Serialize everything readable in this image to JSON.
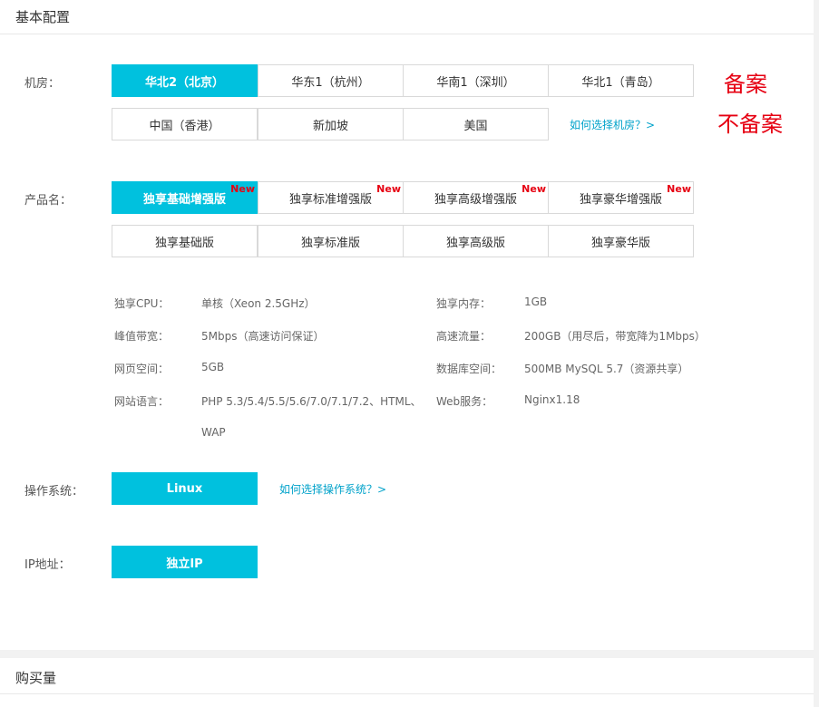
{
  "basic_config": {
    "title": "基本配置",
    "datacenter": {
      "label": "机房：",
      "options": [
        "华北2（北京）",
        "华东1（杭州）",
        "华南1（深圳）",
        "华北1（青岛）",
        "中国（香港）",
        "新加坡",
        "美国"
      ],
      "selected": "华北2（北京）",
      "help": "如何选择机房？>"
    },
    "annotations": {
      "filing": "备案",
      "no_filing": "不备案"
    },
    "product": {
      "label": "产品名：",
      "new_badge": "New",
      "options": [
        "独享基础增强版",
        "独享标准增强版",
        "独享高级增强版",
        "独享豪华增强版",
        "独享基础版",
        "独享标准版",
        "独享高级版",
        "独享豪华版"
      ],
      "selected": "独享基础增强版"
    },
    "specs": {
      "cpu_label": "独享CPU：",
      "cpu_value": "单核（Xeon 2.5GHz）",
      "mem_label": "独享内存：",
      "mem_value": "1GB",
      "bw_label": "峰值带宽：",
      "bw_value": "5Mbps（高速访问保证）",
      "traffic_label": "高速流量：",
      "traffic_value": "200GB（用尽后，带宽降为1Mbps）",
      "web_space_label": "网页空间：",
      "web_space_value": "5GB",
      "db_label": "数据库空间：",
      "db_value": "500MB MySQL 5.7（资源共享）",
      "lang_label": "网站语言：",
      "lang_value_line1": "PHP 5.3/5.4/5.5/5.6/7.0/7.1/7.2、HTML、",
      "lang_value_line2": "WAP",
      "server_label": "Web服务：",
      "server_value": "Nginx1.18"
    },
    "os": {
      "label": "操作系统：",
      "selected": "Linux",
      "help": "如何选择操作系统？>"
    },
    "ip": {
      "label": "IP地址：",
      "selected": "独立IP"
    }
  },
  "quantity": {
    "title": "购买量"
  },
  "colors": {
    "accent": "#00c1de",
    "link": "#00a2ca",
    "annotation": "#e60012",
    "new_badge": "#e60012"
  }
}
